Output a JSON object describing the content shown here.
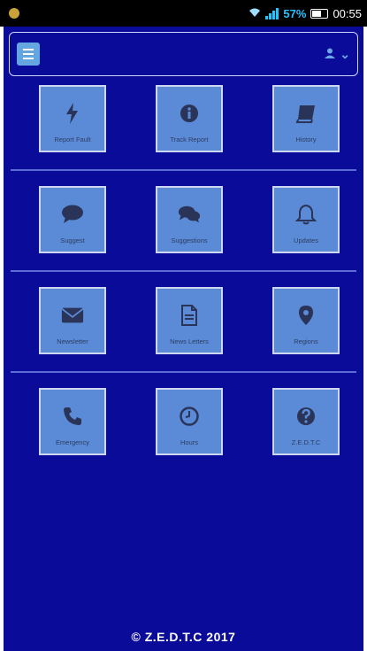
{
  "status_bar": {
    "battery_percent": "57%",
    "time": "00:55"
  },
  "grid": {
    "rows": [
      [
        "Report Fault",
        "Track Report",
        "History"
      ],
      [
        "Suggest",
        "Suggestions",
        "Updates"
      ],
      [
        "Newsletter",
        "News Letters",
        "Regions"
      ],
      [
        "Emergency",
        "Hours",
        "Z.E.D.T.C"
      ]
    ]
  },
  "footer": {
    "copyright": "© Z.E.D.T.C  2017"
  },
  "colors": {
    "background": "#0b0b9a",
    "tile": "#5b8bd6",
    "accent": "#64a6e0"
  },
  "icons": {
    "tiles": [
      "bolt-icon",
      "info-icon",
      "book-icon",
      "comment-icon",
      "comments-icon",
      "bell-icon",
      "envelope-icon",
      "document-icon",
      "map-marker-icon",
      "phone-icon",
      "clock-icon",
      "question-icon"
    ]
  }
}
